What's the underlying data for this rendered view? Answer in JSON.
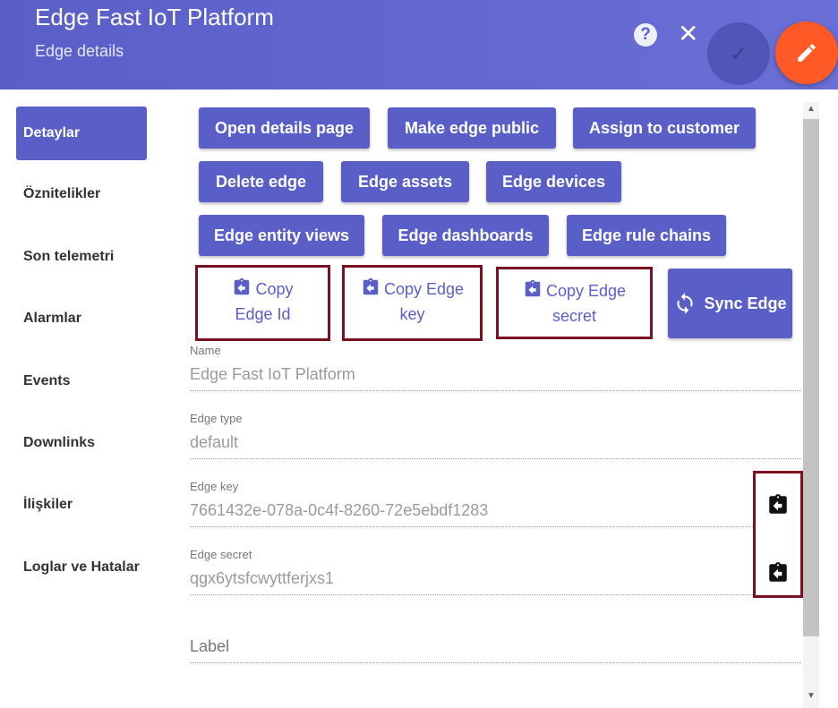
{
  "header": {
    "title": "Edge Fast IoT Platform",
    "subtitle": "Edge details",
    "help_icon": "?",
    "close_icon": "✕",
    "done_icon": "✓"
  },
  "sidebar": {
    "items": [
      {
        "label": "Detaylar",
        "active": true
      },
      {
        "label": "Öznitelikler"
      },
      {
        "label": "Son telemetri"
      },
      {
        "label": "Alarmlar"
      },
      {
        "label": "Events"
      },
      {
        "label": "Downlinks"
      },
      {
        "label": "İlişkiler"
      },
      {
        "label": "Loglar ve Hatalar"
      }
    ]
  },
  "actions": {
    "open_details": "Open details page",
    "make_public": "Make edge public",
    "assign_customer": "Assign to customer",
    "delete_edge": "Delete edge",
    "edge_assets": "Edge assets",
    "edge_devices": "Edge devices",
    "entity_views": "Edge entity views",
    "dashboards": "Edge dashboards",
    "rule_chains": "Edge rule chains",
    "copy_id_1": "Copy",
    "copy_id_2": "Edge Id",
    "copy_key_1": "Copy Edge",
    "copy_key_2": "key",
    "copy_secret_1": "Copy Edge",
    "copy_secret_2": "secret",
    "sync_edge": "Sync Edge"
  },
  "fields": {
    "name_label": "Name",
    "name_value": "Edge Fast IoT Platform",
    "type_label": "Edge type",
    "type_value": "default",
    "key_label": "Edge key",
    "key_value": "7661432e-078a-0c4f-8260-72e5ebdf1283",
    "secret_label": "Edge secret",
    "secret_value": "qgx6ytsfcwyttferjxs1",
    "label_placeholder": "Label"
  },
  "colors": {
    "primary": "#5a5fc8",
    "accent": "#ff5a26",
    "highlight_border": "#7a1022"
  }
}
